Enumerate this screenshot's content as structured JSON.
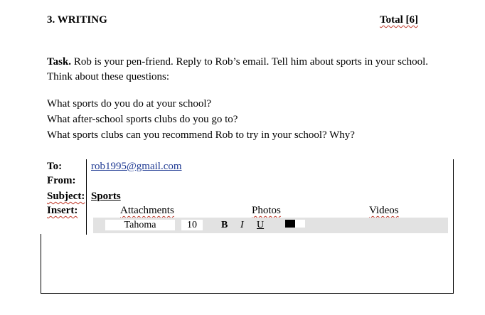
{
  "heading": {
    "section": "3. WRITING",
    "total": "Total [6]"
  },
  "task": {
    "label": "Task.",
    "line1": "Rob is your pen-friend. Reply to Rob’s email. Tell him about sports in your school.",
    "line2": "Think about these questions:"
  },
  "questions": [
    "What sports do you do at your school?",
    "What after-school sports clubs do you go to?",
    "What sports clubs can you recommend Rob to try in your school? Why?"
  ],
  "email": {
    "to_label": "To:",
    "to_value": "rob1995@gmail.com",
    "from_label": "From:",
    "from_value": "",
    "subject_label": "Subject:",
    "subject_value": "Sports",
    "insert_label": "Insert:",
    "insert_options": [
      "Attachments",
      "Photos",
      "Videos"
    ],
    "toolbar": {
      "font": "Tahoma",
      "size": "10",
      "bold": "B",
      "italic": "I",
      "underline": "U",
      "colors": [
        "#000000",
        "#ffffff"
      ]
    },
    "body_text": ""
  }
}
